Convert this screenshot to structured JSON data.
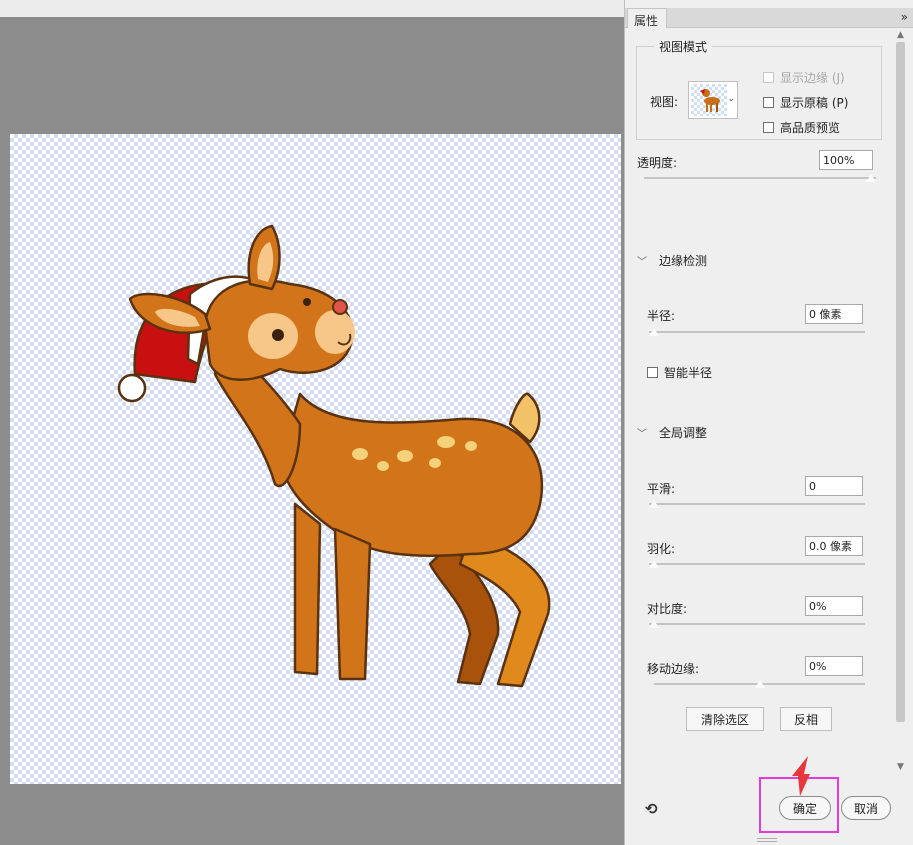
{
  "panel": {
    "tab_label": "属性",
    "collapse_label": "»",
    "view_mode": {
      "title": "视图模式",
      "view_label": "视图:",
      "options": [
        {
          "label": "显示边缘 (J)",
          "checked": false,
          "disabled": true
        },
        {
          "label": "显示原稿 (P)",
          "checked": false,
          "disabled": false
        },
        {
          "label": "高品质预览",
          "checked": false,
          "disabled": false
        }
      ]
    },
    "opacity": {
      "label": "透明度:",
      "value": "100%",
      "slider_level": 1.0
    },
    "edge_detection": {
      "title": "边缘检测",
      "radius": {
        "label": "半径:",
        "value": "0 像素",
        "slider_level": 0.0
      },
      "smart_radius": {
        "label": "智能半径",
        "checked": false
      }
    },
    "global_refine": {
      "title": "全局调整",
      "smooth": {
        "label": "平滑:",
        "value": "0",
        "slider_level": 0.0
      },
      "feather": {
        "label": "羽化:",
        "value": "0.0 像素",
        "slider_level": 0.0
      },
      "contrast": {
        "label": "对比度:",
        "value": "0%",
        "slider_level": 0.0
      },
      "shift_edge": {
        "label": "移动边缘:",
        "value": "0%",
        "slider_level": 0.5
      }
    },
    "buttons": {
      "clear_selection": "清除选区",
      "invert": "反相",
      "ok": "确定",
      "cancel": "取消"
    }
  },
  "colors": {
    "highlight": "#e63adb",
    "arrow": "#e8373c",
    "checker": "#d3dcf0"
  },
  "icons": {
    "reset": "reset-icon",
    "collapse": "double-chevron-right-icon",
    "section_toggle": "chevron-down-icon"
  }
}
